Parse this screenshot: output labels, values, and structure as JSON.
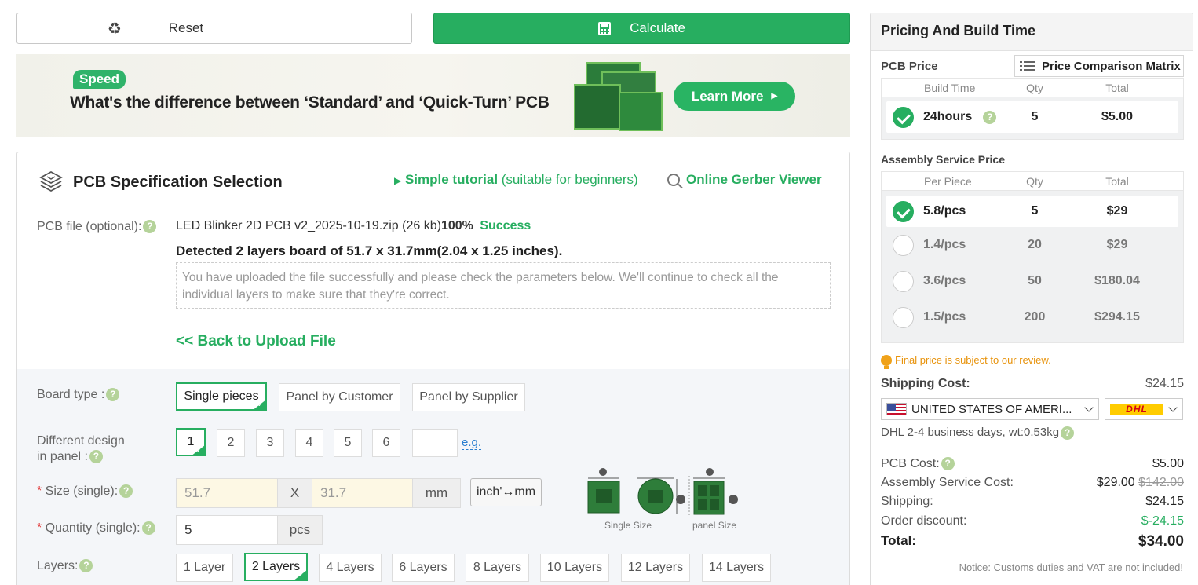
{
  "toolbar": {
    "reset_label": "Reset",
    "calculate_label": "Calculate"
  },
  "banner": {
    "tag": "Speed",
    "headline": "What's the difference between ‘Standard’ and ‘Quick-Turn’ PCB",
    "learn_more": "Learn More"
  },
  "spec": {
    "title": "PCB Specification Selection",
    "tutorial_bold": "Simple tutorial",
    "tutorial_rest": " (suitable for beginners)",
    "gerber_viewer": "Online Gerber Viewer",
    "file_label": "PCB file (optional):",
    "file_name": "LED Blinker 2D PCB v2_2025-10-19.zip (26 kb)",
    "file_pct": "100%",
    "file_status": "Success",
    "detected": "Detected 2 layers board of 51.7 x 31.7mm(2.04 x 1.25 inches).",
    "notice": "You have uploaded the file successfully and please check the parameters below. We'll continue to check all the individual layers to make sure that they're correct.",
    "back": "<< Back to Upload File",
    "board_type_label": "Board type :",
    "board_types": [
      "Single pieces",
      "Panel by Customer",
      "Panel by Supplier"
    ],
    "design_label_1": "Different design",
    "design_label_2": "in panel :",
    "design_options": [
      "1",
      "2",
      "3",
      "4",
      "5",
      "6"
    ],
    "design_eg": "e.g.",
    "size_label": "Size (single):",
    "size_w": "51.7",
    "size_x": "X",
    "size_h": "31.7",
    "size_unit": "mm",
    "unit_toggle": "inch'↔mm",
    "qty_label": "Quantity (single):",
    "qty_value": "5",
    "qty_unit": "pcs",
    "layers_label": "Layers:",
    "layers": [
      "1 Layer",
      "2 Layers",
      "4 Layers",
      "6 Layers",
      "8 Layers",
      "10 Layers",
      "12 Layers",
      "14 Layers"
    ],
    "single_size_caption": "Single Size",
    "panel_size_caption": "panel Size"
  },
  "pricing": {
    "title": "Pricing And Build Time",
    "pcb_price_label": "PCB Price",
    "matrix_button": "Price Comparison Matrix",
    "pcb_headers": [
      "Build Time",
      "Qty",
      "Total"
    ],
    "pcb_rows": [
      {
        "label": "24hours",
        "qty": "5",
        "total": "$5.00"
      }
    ],
    "assembly_label": "Assembly Service Price",
    "assembly_headers": [
      "Per Piece",
      "Qty",
      "Total"
    ],
    "assembly_rows": [
      {
        "label": "5.8/pcs",
        "qty": "5",
        "total": "$29"
      },
      {
        "label": "1.4/pcs",
        "qty": "20",
        "total": "$29"
      },
      {
        "label": "3.6/pcs",
        "qty": "50",
        "total": "$180.04"
      },
      {
        "label": "1.5/pcs",
        "qty": "200",
        "total": "$294.15"
      }
    ],
    "review_notice": "Final price is subject to our review.",
    "shipping_cost_label": "Shipping Cost:",
    "shipping_cost_value": "$24.15",
    "country": "UNITED STATES OF AMERI...",
    "carrier": "DHL",
    "carrier_info": "DHL  2-4 business days, wt:0.53kg",
    "pcb_cost_label": "PCB Cost:",
    "pcb_cost_value": "$5.00",
    "assembly_cost_label": "Assembly Service Cost:",
    "assembly_cost_value": "$29.00",
    "assembly_cost_old": "$142.00",
    "shipping_label": "Shipping:",
    "shipping_value": "$24.15",
    "discount_label": "Order discount:",
    "discount_value": "$-24.15",
    "total_label": "Total:",
    "total_value": "$34.00",
    "customs_notice": "Notice: Customs duties and VAT are not included!"
  },
  "colors": {
    "accent": "#27ae60",
    "warning": "#e8930c",
    "required": "#e03030"
  }
}
